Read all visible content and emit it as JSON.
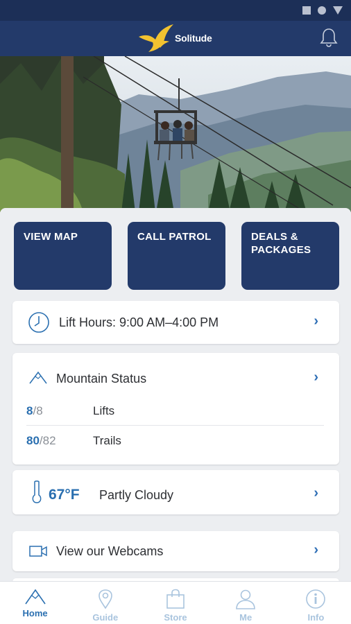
{
  "app": {
    "name": "Solitude"
  },
  "colors": {
    "navy": "#233a6a",
    "accent": "#2a6fb0",
    "logo_gold": "#f2c230",
    "inactive_nav": "#a9c4de"
  },
  "quick_actions": [
    {
      "label": "VIEW MAP"
    },
    {
      "label": "CALL PATROL"
    },
    {
      "label": "DEALS & PACKAGES"
    }
  ],
  "lift_hours": {
    "label": "Lift Hours: 9:00 AM–4:00 PM",
    "icon": "clock-icon"
  },
  "mountain_status": {
    "title": "Mountain Status",
    "icon": "mountain-icon",
    "stats": [
      {
        "open": "8",
        "total": "/8",
        "label": "Lifts"
      },
      {
        "open": "80",
        "total": "/82",
        "label": "Trails"
      }
    ]
  },
  "weather": {
    "temperature": "67°F",
    "condition": "Partly Cloudy",
    "icon": "thermometer-icon"
  },
  "webcams": {
    "label": "View our Webcams",
    "icon": "video-camera-icon"
  },
  "bottom_nav": [
    {
      "label": "Home",
      "icon": "mountain-icon",
      "active": true
    },
    {
      "label": "Guide",
      "icon": "map-pin-icon",
      "active": false
    },
    {
      "label": "Store",
      "icon": "shopping-bag-icon",
      "active": false
    },
    {
      "label": "Me",
      "icon": "person-icon",
      "active": false
    },
    {
      "label": "Info",
      "icon": "info-icon",
      "active": false
    }
  ]
}
